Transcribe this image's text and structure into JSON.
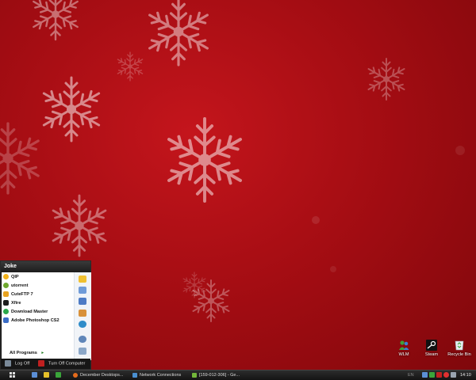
{
  "start_menu": {
    "user": "Joke",
    "programs": [
      {
        "label": "QIP",
        "icon": "qip-icon",
        "color": "#f2b21b"
      },
      {
        "label": "utorrent",
        "icon": "utorrent-icon",
        "color": "#6ea82e"
      },
      {
        "label": "CuteFTP 7",
        "icon": "cuteftp-icon",
        "color": "#e7a21f"
      },
      {
        "label": "Xfire",
        "icon": "xfire-icon",
        "color": "#1c1c1c"
      },
      {
        "label": "Download Master",
        "icon": "download-master-icon",
        "color": "#2aa84a"
      },
      {
        "label": "Adobe Photoshop CS2",
        "icon": "photoshop-icon",
        "color": "#3a6cc5"
      }
    ],
    "all_programs": "All Programs",
    "log_off": "Log Off",
    "turn_off": "Turn Off Computer",
    "right_icons": [
      {
        "icon": "folder-icon",
        "color": "#f0c030"
      },
      {
        "icon": "computer-icon",
        "color": "#6f9bd8"
      },
      {
        "icon": "document-icon",
        "color": "#4d7bc5"
      },
      {
        "icon": "pictures-icon",
        "color": "#d8913a"
      },
      {
        "icon": "internet-icon",
        "color": "#2e8cc9"
      },
      {
        "icon": "search-icon",
        "color": "#5f86b9"
      },
      {
        "icon": "run-icon",
        "color": "#8aa7c8"
      }
    ]
  },
  "desktop_icons": [
    {
      "label": "WLM",
      "icon": "wlm-icon"
    },
    {
      "label": "Steam",
      "icon": "steam-icon"
    },
    {
      "label": "Recycle Bin",
      "icon": "recycle-bin-icon"
    }
  ],
  "taskbar": {
    "tasks": [
      {
        "label": "December Desktops...",
        "icon": "firefox-icon",
        "color": "#e46b1c"
      },
      {
        "label": "Network Connections",
        "icon": "network-icon",
        "color": "#4a8fd0"
      },
      {
        "label": "[159-012-306] - Ge...",
        "icon": "app-icon",
        "color": "#73b73a"
      }
    ],
    "lang": "EN",
    "clock": "14:10"
  },
  "colors": {
    "wallpaper": "#a50d13",
    "accent": "#111111"
  }
}
